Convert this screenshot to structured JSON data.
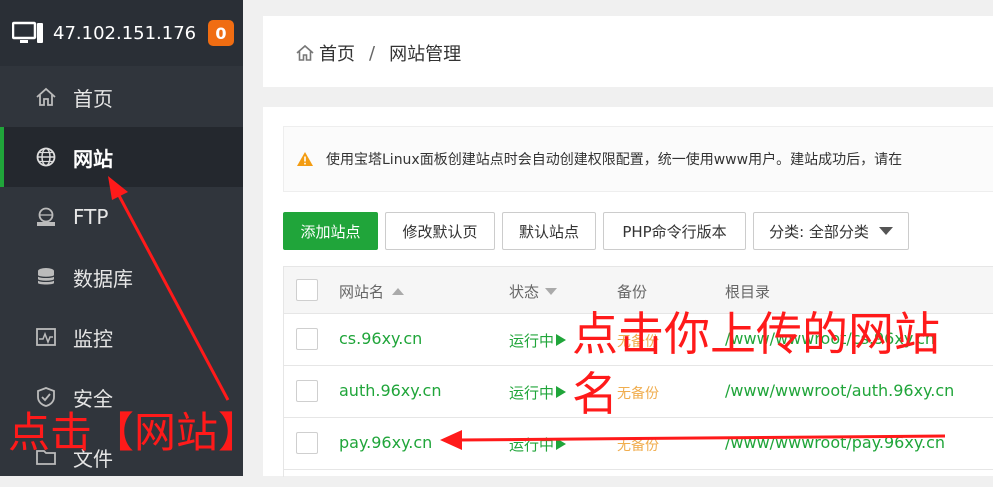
{
  "sidebar": {
    "ip": "47.102.151.176",
    "badge": "0",
    "items": [
      {
        "label": "首页",
        "icon": "home-icon"
      },
      {
        "label": "网站",
        "icon": "globe-icon"
      },
      {
        "label": "FTP",
        "icon": "ftp-icon"
      },
      {
        "label": "数据库",
        "icon": "database-icon"
      },
      {
        "label": "监控",
        "icon": "monitor-chart-icon"
      },
      {
        "label": "安全",
        "icon": "shield-icon"
      },
      {
        "label": "文件",
        "icon": "folder-icon"
      }
    ]
  },
  "breadcrumb": {
    "home": "首页",
    "separator": "/",
    "current": "网站管理"
  },
  "notice": {
    "text": "使用宝塔Linux面板创建站点时会自动创建权限配置，统一使用www用户。建站成功后，请在"
  },
  "toolbar": {
    "add_site": "添加站点",
    "edit_default": "修改默认页",
    "default_site": "默认站点",
    "php_cli": "PHP命令行版本",
    "category": "分类: 全部分类"
  },
  "table": {
    "headers": {
      "name": "网站名",
      "status": "状态",
      "backup": "备份",
      "root": "根目录"
    },
    "rows": [
      {
        "name": "cs.96xy.cn",
        "status": "运行中",
        "backup": "无备份",
        "root": "/www/wwwroot/cs.96xy.cn"
      },
      {
        "name": "auth.96xy.cn",
        "status": "运行中",
        "backup": "无备份",
        "root": "/www/wwwroot/auth.96xy.cn"
      },
      {
        "name": "pay.96xy.cn",
        "status": "运行中",
        "backup": "无备份",
        "root": "/www/wwwroot/pay.96xy.cn"
      }
    ]
  },
  "annotations": {
    "click_site": "点击【网站】",
    "click_upload_line1": "点击你上传的网站",
    "click_upload_line2": "名"
  },
  "colors": {
    "accent": "#20a53a",
    "sidebar": "#30353c",
    "badge": "#f06d12",
    "annotation": "#ff1a1a",
    "backup": "#f0ad4e"
  }
}
